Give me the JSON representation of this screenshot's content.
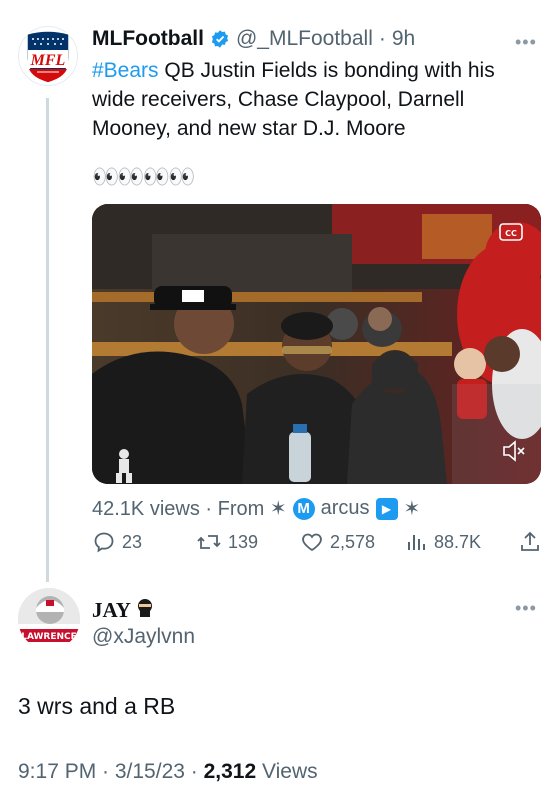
{
  "tweet": {
    "author_name": "MLFootball",
    "handle": "@_MLFootball",
    "separator": "·",
    "time": "9h",
    "hashtag": "#Bears",
    "text": " QB Justin Fields is bonding with his wide receivers, Chase Claypool, Darnell Mooney, and new star D.J. Moore",
    "emoji": "👀👀👀👀",
    "avatar_logo_text": "MFL",
    "views_label": "42.1K views · From ✶",
    "marcus_initial": "M",
    "marcus_rest": "arcus",
    "trail_star": "✶",
    "stats": {
      "replies": "23",
      "retweets": "139",
      "likes": "2,578",
      "views": "88.7K"
    },
    "icons": [
      "verified-badge-icon",
      "more-icon",
      "reply-icon",
      "retweet-icon",
      "like-icon",
      "views-icon",
      "share-icon",
      "mute-icon",
      "cc-icon"
    ]
  },
  "reply": {
    "author_name": "JAY",
    "handle": "@xJaylvnn",
    "text": "3 wrs and a RB",
    "avatar_text": "LAWRENCE",
    "timestamp": "9:17 PM · 3/15/23 · ",
    "view_count": "2,312",
    "views_word": " Views"
  },
  "colors": {
    "accent": "#1d9bf0",
    "secondary_text": "#536471",
    "primary_text": "#0f1419",
    "thread_line": "#cfd9de"
  }
}
